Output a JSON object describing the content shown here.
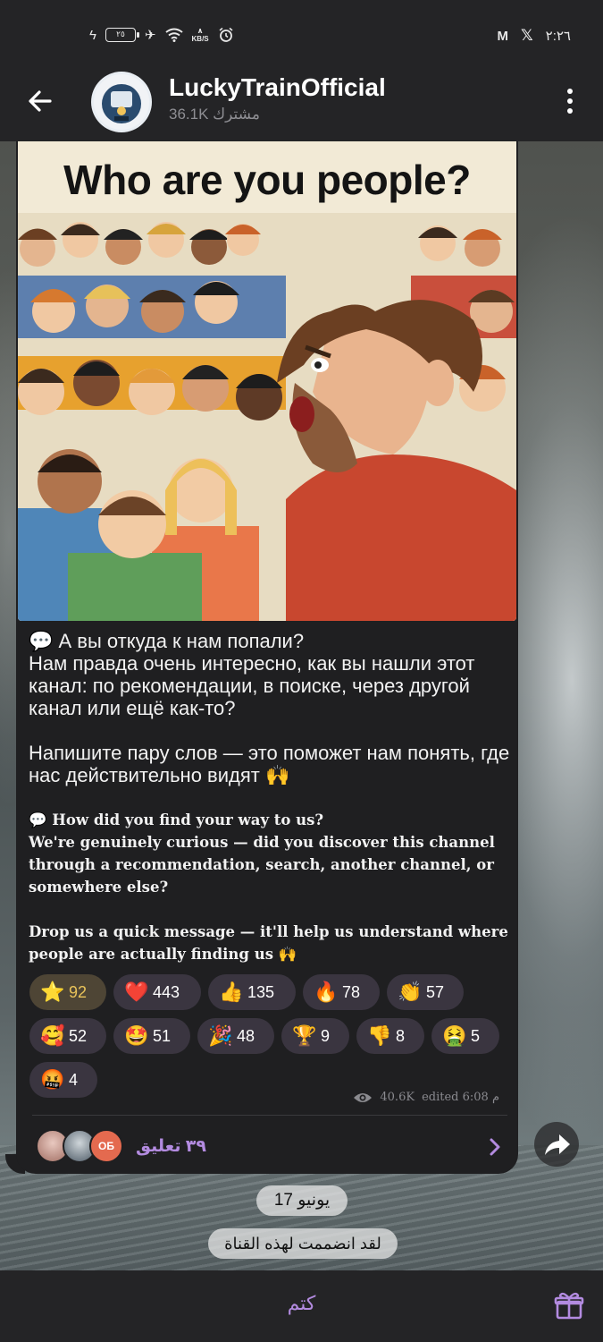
{
  "status_bar": {
    "time": "٢:٢٦",
    "battery": "٢٥",
    "speed_value": "٨",
    "speed_unit": "KB/S"
  },
  "header": {
    "channel_name": "LuckyTrainOfficial",
    "subscribers": "36.1K مشترك"
  },
  "post": {
    "image_title": "Who are you people?",
    "text_ru": [
      "💬 А вы откуда к нам попали?\nНам правда очень интересно, как вы нашли этот канал: по рекомендации, в поиске, через другой канал или ещё как-то?",
      "Напишите пару слов — это поможет нам понять, где нас действительно видят 🙌"
    ],
    "text_en": [
      "💬 How did you find your way to us?\nWe're genuinely curious — did you discover this channel through a recommendation, search, another channel, or somewhere else?",
      "Drop us a quick message — it'll help us understand where people are actually finding us 🙌"
    ],
    "reactions": [
      {
        "icon": "⭐",
        "count": "92",
        "active": true
      },
      {
        "icon": "❤️",
        "count": "443"
      },
      {
        "icon": "👍",
        "count": "135"
      },
      {
        "icon": "🔥",
        "count": "78"
      },
      {
        "icon": "👏",
        "count": "57"
      },
      {
        "icon": "🥰",
        "count": "52"
      },
      {
        "icon": "🤩",
        "count": "51"
      },
      {
        "icon": "🎉",
        "count": "48"
      },
      {
        "icon": "🏆",
        "count": "9"
      },
      {
        "icon": "👎",
        "count": "8"
      },
      {
        "icon": "🤮",
        "count": "5"
      },
      {
        "icon": "🤬",
        "count": "4"
      }
    ],
    "views": "40.6K",
    "edited": "edited 6:08 م",
    "comments": "٣٩ تعليق",
    "commenter_initials": "ОБ"
  },
  "date_separator": "17 يونيو",
  "service_message": "لقد انضممت لهذه القناة",
  "bottom_bar": {
    "mute_label": "كتم"
  },
  "colors": {
    "accent": "#b38be0",
    "bubble": "#1f1f21",
    "bar": "#242426",
    "star_reaction": "#e9c35a"
  }
}
